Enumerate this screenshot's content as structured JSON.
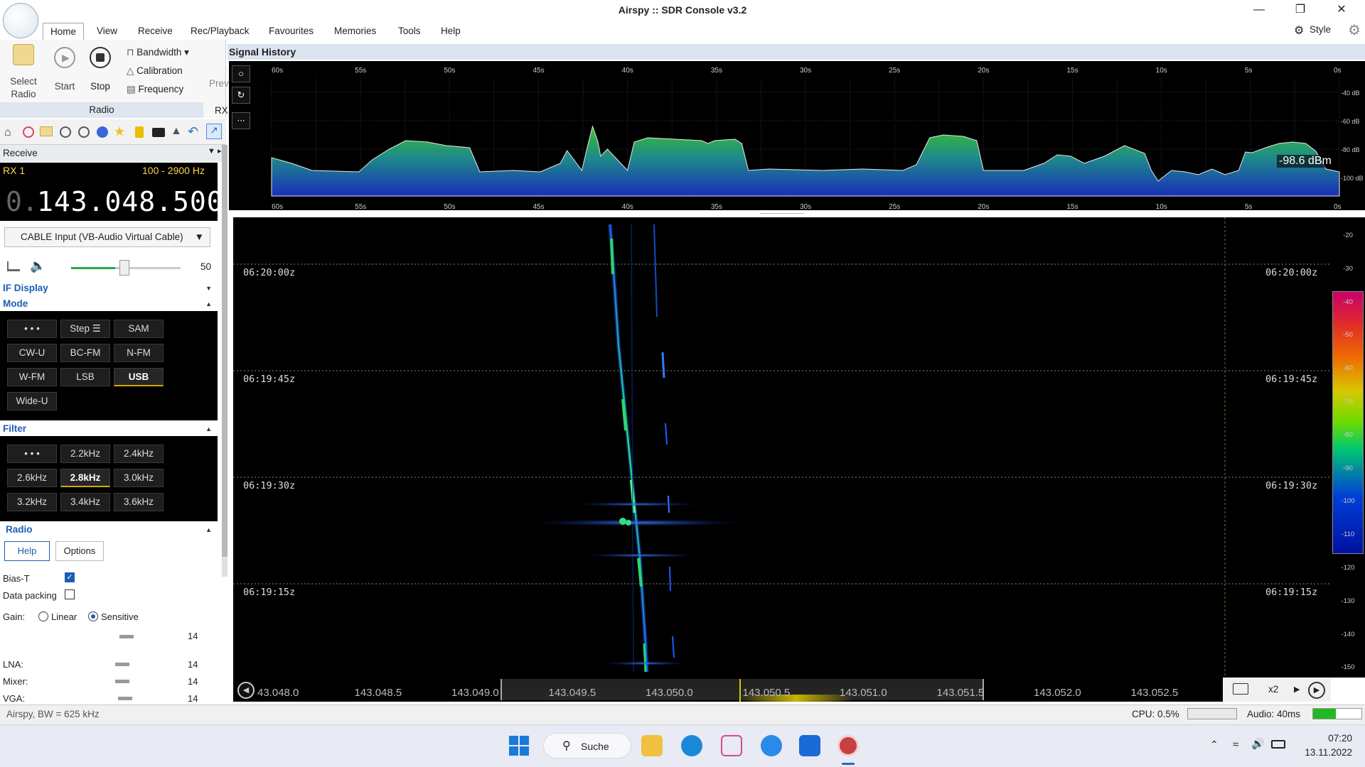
{
  "window": {
    "title": "Airspy :: SDR Console v3.2"
  },
  "menu": [
    "Home",
    "View",
    "Receive",
    "Rec/Playback",
    "Favourites",
    "Memories",
    "Tools",
    "Help"
  ],
  "style_label": "Style",
  "ribbon": {
    "select_radio": "Select Radio",
    "start": "Start",
    "stop": "Stop",
    "bandwidth": "Bandwidth",
    "calibration": "Calibration",
    "frequency": "Frequency",
    "prev": "Prev",
    "rx": "RX",
    "group_label": "Radio"
  },
  "receive": {
    "header": "Receive",
    "rx": "RX 1",
    "bandwidth": "100 - 2900 Hz",
    "freq_dim": "0.",
    "freq": "143.048.500",
    "input": "CABLE Input (VB-Audio Virtual Cable)",
    "volume": "50"
  },
  "sections": {
    "if_display": "IF Display",
    "mode": "Mode",
    "filter": "Filter",
    "radio": "Radio"
  },
  "mode_buttons": [
    "• • •",
    "Step ☰",
    "SAM",
    "CW-U",
    "BC-FM",
    "N-FM",
    "W-FM",
    "LSB",
    "USB",
    "Wide-U"
  ],
  "mode_selected": "USB",
  "filter_buttons": [
    "• • •",
    "2.2kHz",
    "2.4kHz",
    "2.6kHz",
    "2.8kHz",
    "3.0kHz",
    "3.2kHz",
    "3.4kHz",
    "3.6kHz"
  ],
  "filter_selected": "2.8kHz",
  "radio": {
    "help": "Help",
    "options": "Options",
    "bias_t": "Bias-T",
    "bias_t_checked": true,
    "data_packing": "Data packing",
    "data_packing_checked": false,
    "gain": "Gain:",
    "linear": "Linear",
    "sensitive": "Sensitive",
    "gain_mode": "Sensitive",
    "gain_value": "14",
    "lna": "LNA:",
    "lna_value": "14",
    "mixer": "Mixer:",
    "mixer_value": "14",
    "vga": "VGA:",
    "vga_value": "14"
  },
  "signal_history": {
    "title": "Signal History",
    "readout": "-98.6 dBm",
    "time_ticks": [
      "60s",
      "55s",
      "50s",
      "45s",
      "40s",
      "35s",
      "30s",
      "25s",
      "20s",
      "15s",
      "10s",
      "5s",
      "0s"
    ],
    "db_ticks": [
      "-40 dB",
      "-60 dB",
      "-80 dB",
      "-100 dB"
    ]
  },
  "waterfall": {
    "timestamps": [
      "06:20:00z",
      "06:19:45z",
      "06:19:30z",
      "06:19:15z"
    ],
    "scale": [
      "-20",
      "-30",
      "-40",
      "-50",
      "-60",
      "-70",
      "-80",
      "-90",
      "-100",
      "-110",
      "-120",
      "-130",
      "-140",
      "-150"
    ],
    "freq_ticks": [
      "43.048.0",
      "143.048.5",
      "143.049.0",
      "143.049.5",
      "143.050.0",
      "143.050.5",
      "143.051.0",
      "143.051.5",
      "143.052.0",
      "143.052.5"
    ],
    "zoom": "x2"
  },
  "status": {
    "left": "Airspy, BW = 625 kHz",
    "cpu": "CPU: 0.5%",
    "audio": "Audio: 40ms"
  },
  "taskbar": {
    "search": "Suche",
    "time": "07:20",
    "date": "13.11.2022"
  },
  "colors": {
    "accent": "#1a5fb4",
    "selected_underline": "#d8a800",
    "freq_yellow": "#ffd24a"
  }
}
